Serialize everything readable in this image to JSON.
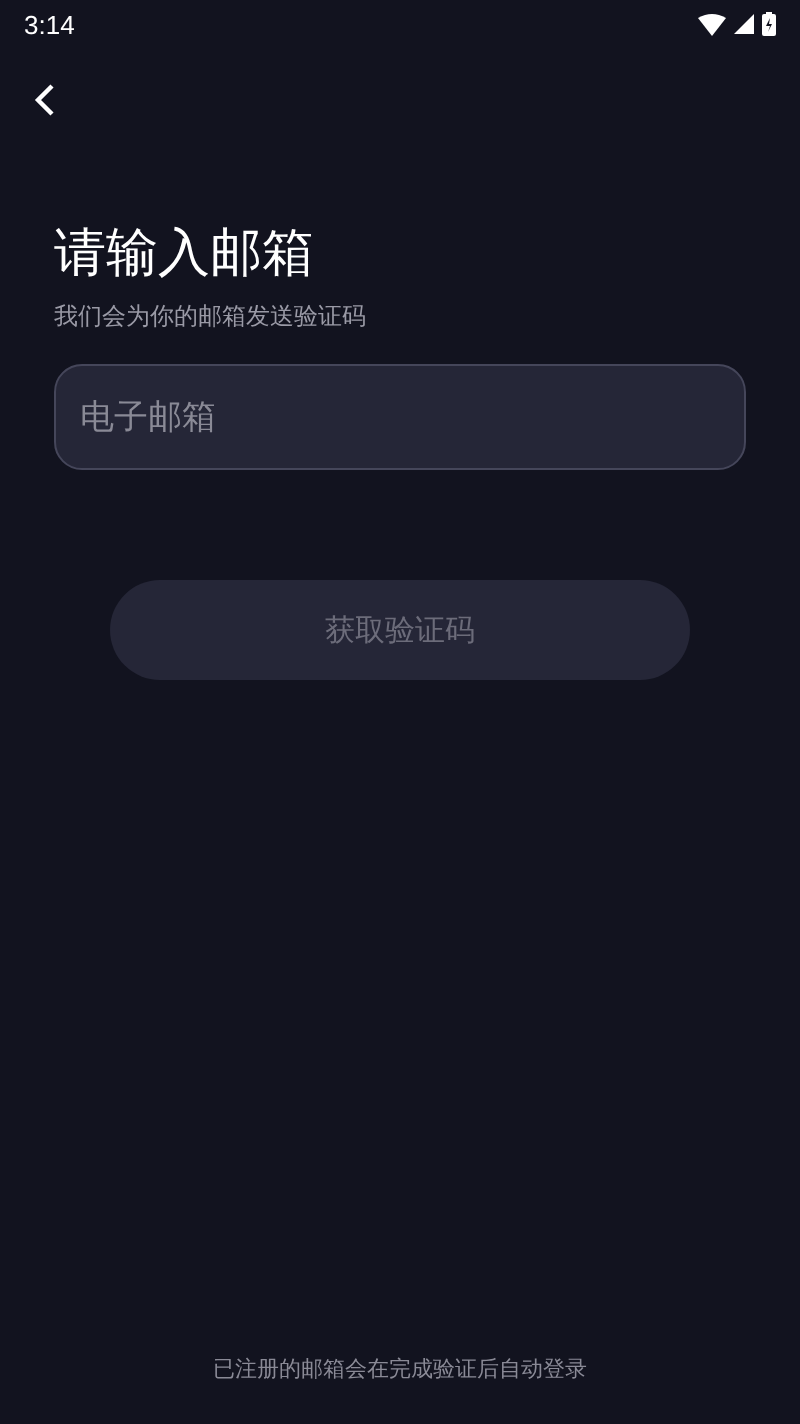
{
  "status_bar": {
    "time": "3:14"
  },
  "title": "请输入邮箱",
  "subtitle": "我们会为你的邮箱发送验证码",
  "email_field": {
    "placeholder": "电子邮箱"
  },
  "submit_button": {
    "label": "获取验证码",
    "disabled": true
  },
  "footer_note": "已注册的邮箱会在完成验证后自动登录"
}
